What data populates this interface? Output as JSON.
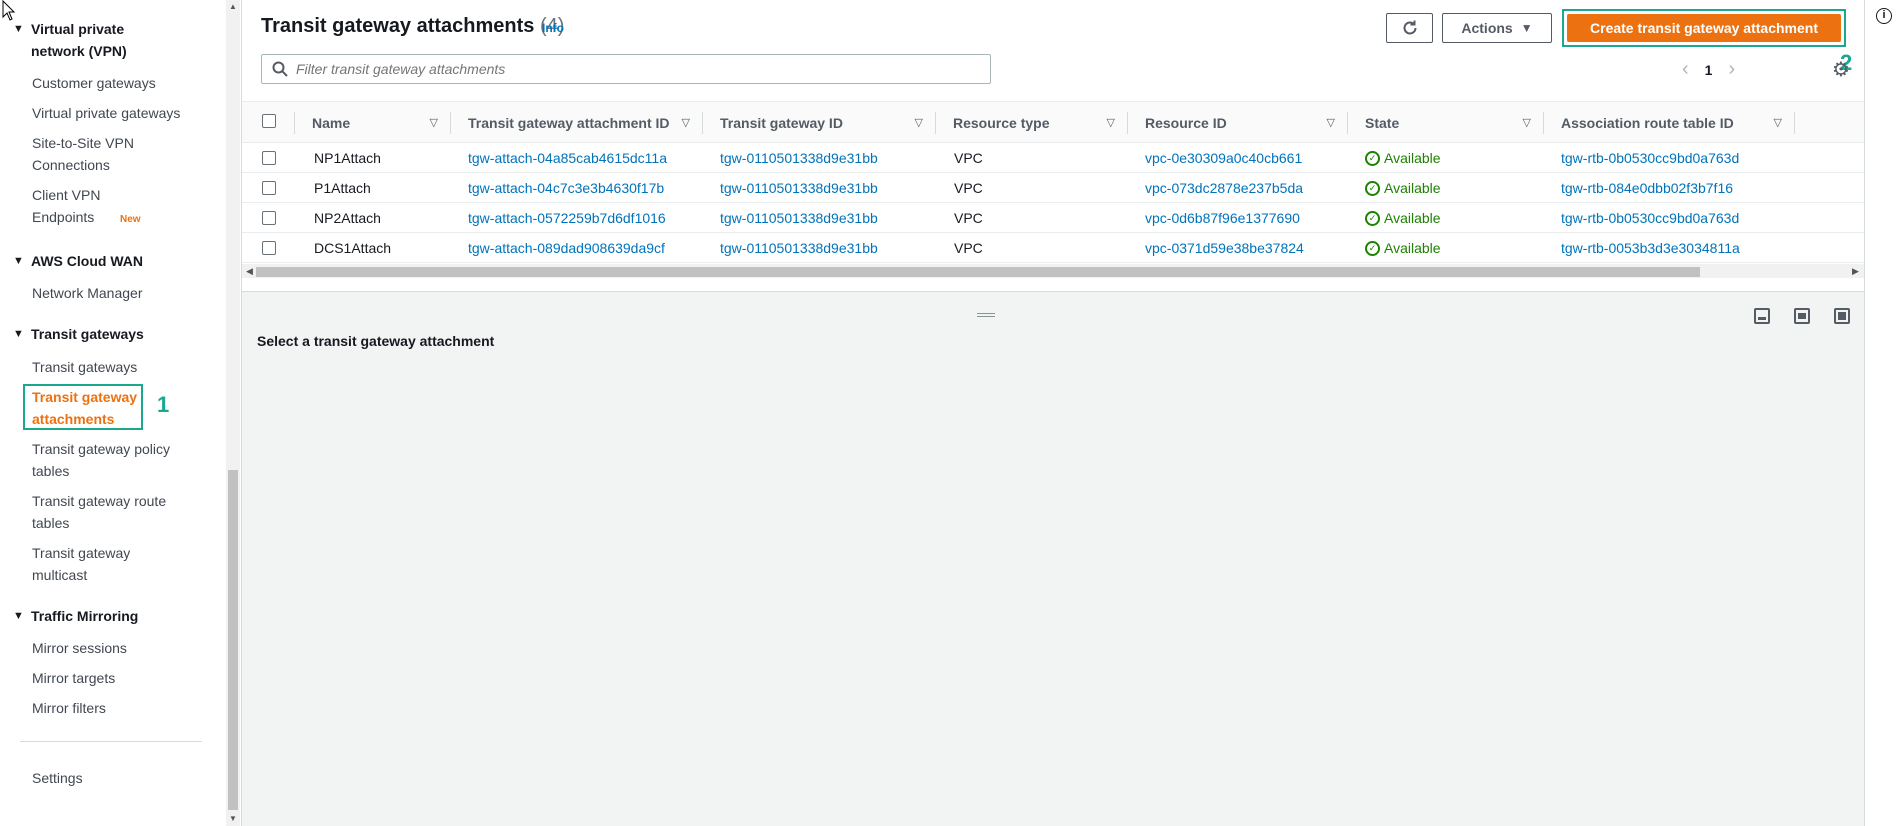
{
  "sidebar": {
    "sections": [
      {
        "title": "Virtual private network (VPN)",
        "items": [
          "Customer gateways",
          "Virtual private gateways",
          "Site-to-Site VPN Connections",
          "Client VPN Endpoints"
        ]
      },
      {
        "title": "AWS Cloud WAN",
        "items": [
          "Network Manager"
        ]
      },
      {
        "title": "Transit gateways",
        "items": [
          "Transit gateways",
          "Transit gateway attachments",
          "Transit gateway policy tables",
          "Transit gateway route tables",
          "Transit gateway multicast"
        ]
      },
      {
        "title": "Traffic Mirroring",
        "items": [
          "Mirror sessions",
          "Mirror targets",
          "Mirror filters"
        ]
      }
    ],
    "new_badge": "New",
    "settings": "Settings",
    "active_item": "Transit gateway attachments",
    "step1": "1"
  },
  "header": {
    "title": "Transit gateway attachments",
    "count": "(4)",
    "info": "Info",
    "actions_label": "Actions",
    "create_label": "Create transit gateway attachment",
    "step2": "2"
  },
  "filter": {
    "placeholder": "Filter transit gateway attachments"
  },
  "pagination": {
    "page": "1"
  },
  "table": {
    "columns": [
      "Name",
      "Transit gateway attachment ID",
      "Transit gateway ID",
      "Resource type",
      "Resource ID",
      "State",
      "Association route table ID"
    ],
    "rows": [
      {
        "name": "NP1Attach",
        "attachment_id": "tgw-attach-04a85cab4615dc11a",
        "tgw_id": "tgw-0110501338d9e31bb",
        "resource_type": "VPC",
        "resource_id": "vpc-0e30309a0c40cb661",
        "state": "Available",
        "route_table": "tgw-rtb-0b0530cc9bd0a763d"
      },
      {
        "name": "P1Attach",
        "attachment_id": "tgw-attach-04c7c3e3b4630f17b",
        "tgw_id": "tgw-0110501338d9e31bb",
        "resource_type": "VPC",
        "resource_id": "vpc-073dc2878e237b5da",
        "state": "Available",
        "route_table": "tgw-rtb-084e0dbb02f3b7f16"
      },
      {
        "name": "NP2Attach",
        "attachment_id": "tgw-attach-0572259b7d6df1016",
        "tgw_id": "tgw-0110501338d9e31bb",
        "resource_type": "VPC",
        "resource_id": "vpc-0d6b87f96e1377690",
        "state": "Available",
        "route_table": "tgw-rtb-0b0530cc9bd0a763d"
      },
      {
        "name": "DCS1Attach",
        "attachment_id": "tgw-attach-089dad908639da9cf",
        "tgw_id": "tgw-0110501338d9e31bb",
        "resource_type": "VPC",
        "resource_id": "vpc-0371d59e38be37824",
        "state": "Available",
        "route_table": "tgw-rtb-0053b3d3e3034811a"
      }
    ]
  },
  "details": {
    "title": "Select a transit gateway attachment"
  },
  "colors": {
    "accent": "#ec7211",
    "link": "#0073bb",
    "success": "#1d8102",
    "annotation": "#1aa88f"
  }
}
